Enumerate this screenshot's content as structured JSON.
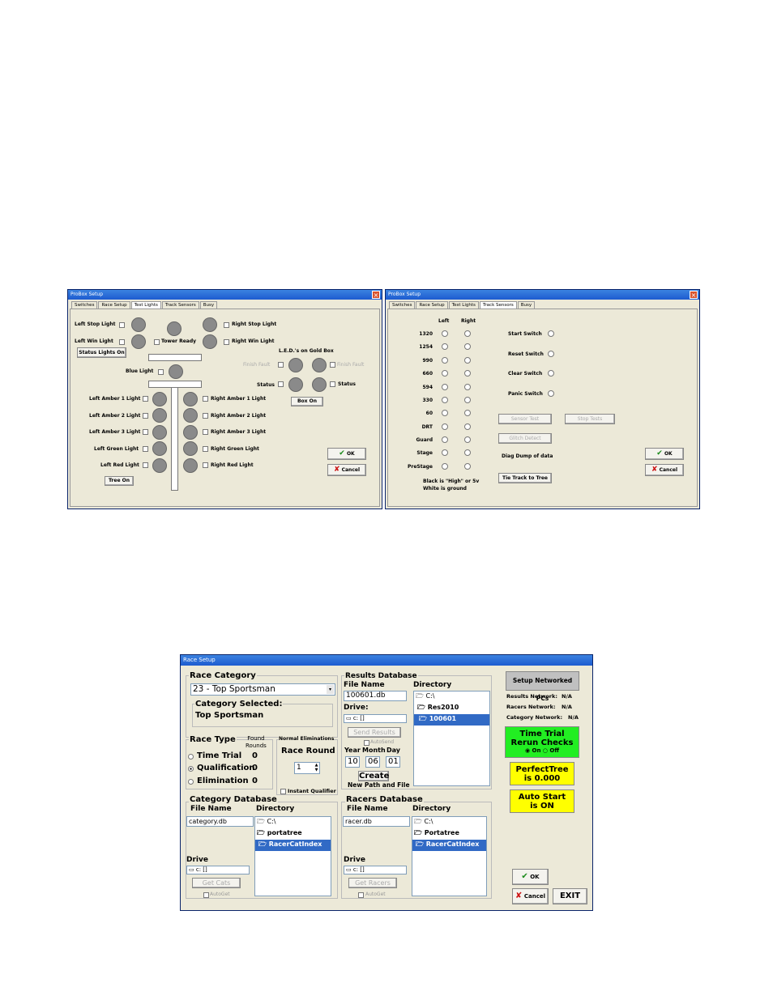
{
  "w1": {
    "title": "ProBox Setup",
    "tabs": [
      "Switches",
      "Race Setup",
      "Test Lights",
      "Track Sensors",
      "Busy"
    ],
    "left_stop": "Left Stop Light",
    "right_stop": "Right Stop Light",
    "left_win": "Left Win Light",
    "tower_ready": "Tower Ready",
    "right_win": "Right Win Light",
    "status_lights_on": "Status Lights On",
    "leds_title": "L.E.D.'s on Gold Box",
    "finish_fault": "Finish Fault",
    "status": "Status",
    "blue_light": "Blue Light",
    "box_on": "Box On",
    "amber_left": [
      "Left Amber 1 Light",
      "Left Amber 2 Light",
      "Left Amber 3 Light",
      "Left Green Light",
      "Left Red Light"
    ],
    "amber_right": [
      "Right Amber 1 Light",
      "Right Amber 2 Light",
      "Right Amber 3 Light",
      "Right Green Light",
      "Right Red Light"
    ],
    "tree_on": "Tree On",
    "ok": "OK",
    "cancel": "Cancel"
  },
  "w2": {
    "title": "ProBox Setup",
    "tabs": [
      "Switches",
      "Race Setup",
      "Test Lights",
      "Track Sensors",
      "Busy"
    ],
    "col_left": "Left",
    "col_right": "Right",
    "rows": [
      "1320",
      "1254",
      "990",
      "660",
      "594",
      "330",
      "60",
      "DRT",
      "Guard",
      "Stage",
      "PreStage"
    ],
    "switches": [
      "Start Switch",
      "Reset Switch",
      "Clear Switch",
      "Panic Switch"
    ],
    "sensor_test": "Sensor Test",
    "stop_tests": "Stop Tests",
    "glitch_detect": "Glitch Detect",
    "diag_dump": "Diag Dump of data",
    "tie_track": "Tie Track to Tree",
    "note1": "Black is \"High\" or 5v",
    "note2": "White is ground",
    "ok": "OK",
    "cancel": "Cancel"
  },
  "w3": {
    "title": "Race Setup",
    "race_category": "Race Category",
    "category_value": "23 - Top Sportsman",
    "category_selected": "Category Selected:",
    "category_selected_value": "Top Sportsman",
    "results_db": "Results Database",
    "file_name": "File Name",
    "directory": "Directory",
    "results_file": "100601.db",
    "drive": "Drive:",
    "drive_value": "c: []",
    "results_dirs": [
      "C:\\",
      "Res2010",
      "100601"
    ],
    "send_results": "Send Results",
    "autosend": "AutoSend",
    "year": "Year",
    "month": "Month",
    "day": "Day",
    "year_val": "10",
    "month_val": "06",
    "day_val": "01",
    "create": "Create",
    "new_path": "New Path and File",
    "setup_networked": "Setup Networked PCs",
    "results_network": "Results Network:",
    "racers_network": "Racers Network:",
    "category_network": "Category Network:",
    "na": "N/A",
    "time_trial_rerun": "Time Trial\nRerun Checks",
    "on": "On",
    "off": "Off",
    "perfect_tree": "PerfectTree\nis 0.000",
    "auto_start": "Auto Start\nis ON",
    "race_type": "Race Type",
    "found_rounds": "Found\nRounds",
    "race_types": [
      "Time Trial",
      "Qualification",
      "Elimination"
    ],
    "race_type_counts": [
      "0",
      "0",
      "0"
    ],
    "normal_elims": "Normal Eliminations",
    "race_round": "Race Round",
    "race_round_val": "1",
    "instant_qualifier": "Instant Qualifier",
    "category_db": "Category Database",
    "cat_file": "category.db",
    "cat_dirs": [
      "C:\\",
      "portatree",
      "RacerCatIndex"
    ],
    "drive_label": "Drive",
    "get_cats": "Get Cats",
    "autoget": "AutoGet",
    "racers_db": "Racers Database",
    "racer_file": "racer.db",
    "racer_dirs": [
      "C:\\",
      "Portatree",
      "RacerCatIndex"
    ],
    "get_racers": "Get Racers",
    "ok": "OK",
    "cancel": "Cancel",
    "exit": "EXIT"
  },
  "colors": {
    "green_box": "#22ee22",
    "yellow_box": "#ffff00",
    "gray_box": "#c0c0c0",
    "selection": "#316ac5"
  }
}
